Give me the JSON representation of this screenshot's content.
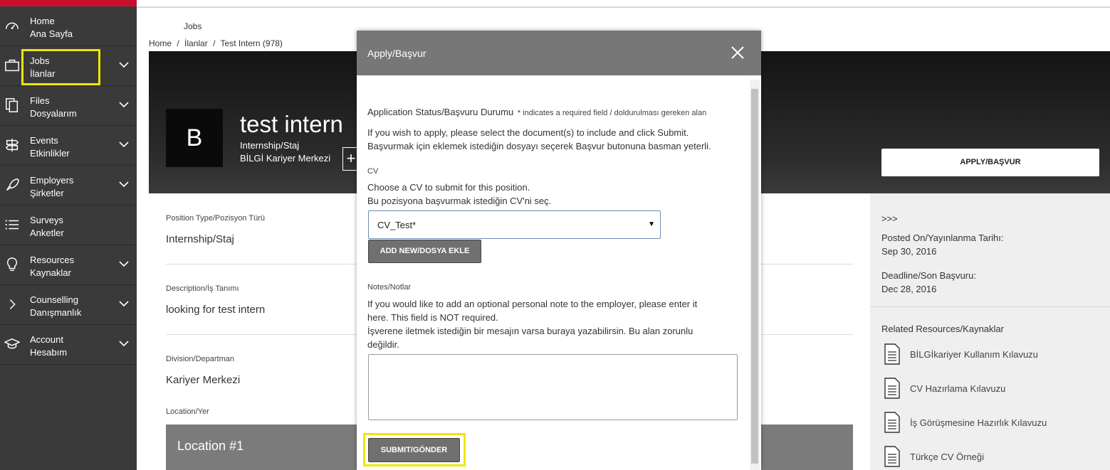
{
  "sidebar": {
    "items": [
      {
        "label_en": "Home",
        "label_tr": "Ana Sayfa",
        "icon": "dashboard-icon",
        "has_chevron": false
      },
      {
        "label_en": "Jobs",
        "label_tr": "İlanlar",
        "icon": "briefcase-icon",
        "has_chevron": true
      },
      {
        "label_en": "Files",
        "label_tr": "Dosyalarım",
        "icon": "files-icon",
        "has_chevron": true
      },
      {
        "label_en": "Events",
        "label_tr": "Etkinlikler",
        "icon": "signpost-icon",
        "has_chevron": true
      },
      {
        "label_en": "Employers",
        "label_tr": "Şirketler",
        "icon": "rocket-icon",
        "has_chevron": true
      },
      {
        "label_en": "Surveys",
        "label_tr": "Anketler",
        "icon": "list-icon",
        "has_chevron": false
      },
      {
        "label_en": "Resources",
        "label_tr": "Kaynaklar",
        "icon": "lightbulb-icon",
        "has_chevron": true
      },
      {
        "label_en": "Counselling",
        "label_tr": "Danışmanlık",
        "icon": "chevron-right-icon",
        "has_chevron": true
      },
      {
        "label_en": "Account",
        "label_tr": "Hesabım",
        "icon": "graduation-cap-icon",
        "has_chevron": true
      }
    ]
  },
  "page": {
    "section_title": "Jobs",
    "breadcrumb": [
      "Home",
      "/",
      "İlanlar",
      "/",
      "Test Intern (978)"
    ],
    "logo_letter": "B",
    "job_title": "test intern",
    "job_type": "Internship/Staj",
    "employer": "BİLGİ Kariyer Merkezi",
    "plus_label": "+",
    "apply_label": "APPLY/BAŞVUR",
    "position_type_label": "Position Type/Pozisyon Türü",
    "position_type_value": "Internship/Staj",
    "description_label": "Description/İş Tanımı",
    "description_value": "looking for test intern",
    "division_label": "Division/Departman",
    "division_value": "Kariyer Merkezi",
    "location_label": "Location/Yer",
    "location_box_title": "Location #1"
  },
  "right_panel": {
    "toggle": ">>>",
    "posted_label": "Posted On/Yayınlanma Tarihı:",
    "posted_value": "Sep 30, 2016",
    "deadline_label": "Deadline/Son Başvuru:",
    "deadline_value": "Dec 28, 2016",
    "related_title": "Related Resources/Kaynaklar",
    "resources": [
      "BİLGİkariyer Kullanım Kılavuzu",
      "CV Hazırlama Kılavuzu",
      "İş Görüşmesine Hazırlık Kılavuzu",
      "Türkçe CV Örneği"
    ]
  },
  "modal": {
    "title": "Apply/Başvur",
    "status_heading": "Application Status/Başvuru Durumu",
    "required_note": "* indicates a required field / doldurulması gereken alan",
    "intro_line1": "If you wish to apply, please select the document(s) to include and click Submit.",
    "intro_line2": "Başvurmak için eklemek istediğin dosyayı seçerek Başvur butonuna basman yeterli.",
    "cv_label": "CV",
    "cv_help1": "Choose a CV to submit for this position.",
    "cv_help2": "Bu pozisyona başvurmak istediğin CV'ni seç.",
    "cv_selected": "CV_Test*",
    "add_new_label": "ADD NEW/DOSYA EKLE",
    "notes_label": "Notes/Notlar",
    "notes_help1": "If you would like to add an optional personal note to the employer, please enter it",
    "notes_help2": "here. This field is NOT required.",
    "notes_help3": "İşverene iletmek istediğin bir mesajın varsa buraya yazabilirsin. Bu alan zorunlu",
    "notes_help4": "değildir.",
    "notes_value": "",
    "submit_label": "SUBMIT/GÖNDER"
  },
  "colors": {
    "sidebar_bg": "#3a3a3a",
    "brand_red": "#c8102e",
    "highlight_yellow": "#f2e600",
    "modal_header": "#777778",
    "button_grey": "#707070"
  }
}
